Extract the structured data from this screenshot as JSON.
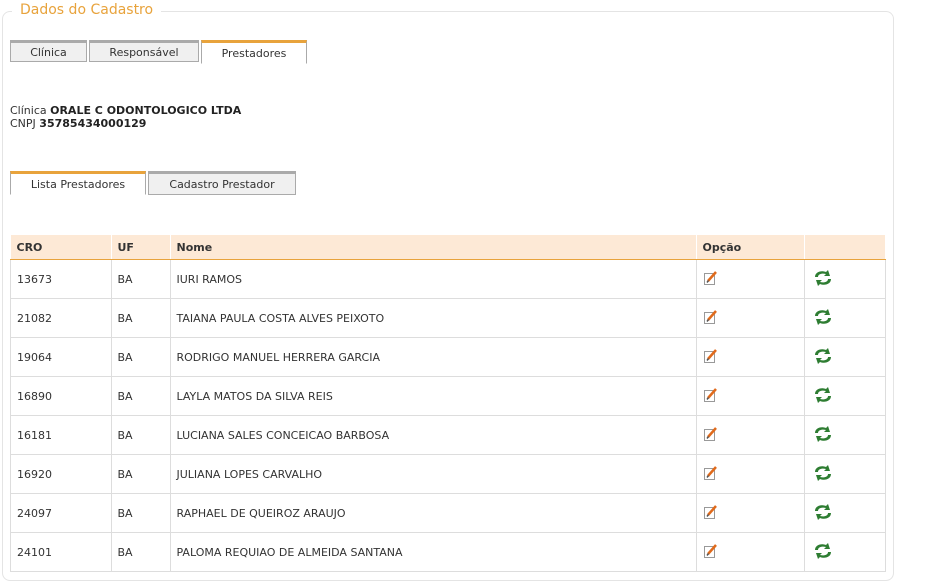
{
  "legend": "Dados do Cadastro",
  "top_tabs": [
    "Clínica",
    "Responsável",
    "Prestadores"
  ],
  "clinica_label": "Clínica",
  "clinica_name": "ORALE C ODONTOLOGICO LTDA",
  "cnpj_label": "CNPJ",
  "cnpj_value": "35785434000129",
  "sub_tabs": [
    "Lista Prestadores",
    "Cadastro Prestador"
  ],
  "table": {
    "headers": [
      "CRO",
      "UF",
      "Nome",
      "Opção",
      ""
    ],
    "rows": [
      {
        "cro": "13673",
        "uf": "BA",
        "nome": "IURI RAMOS"
      },
      {
        "cro": "21082",
        "uf": "BA",
        "nome": "TAIANA PAULA COSTA ALVES PEIXOTO"
      },
      {
        "cro": "19064",
        "uf": "BA",
        "nome": "RODRIGO MANUEL HERRERA GARCIA"
      },
      {
        "cro": "16890",
        "uf": "BA",
        "nome": "LAYLA MATOS DA SILVA REIS"
      },
      {
        "cro": "16181",
        "uf": "BA",
        "nome": "LUCIANA SALES CONCEICAO BARBOSA"
      },
      {
        "cro": "16920",
        "uf": "BA",
        "nome": "JULIANA LOPES CARVALHO"
      },
      {
        "cro": "24097",
        "uf": "BA",
        "nome": "RAPHAEL DE QUEIROZ ARAUJO"
      },
      {
        "cro": "24101",
        "uf": "BA",
        "nome": "PALOMA REQUIAO DE ALMEIDA SANTANA"
      }
    ]
  },
  "icons": {
    "edit": "edit-icon",
    "swap": "swap-arrows-icon"
  },
  "colors": {
    "accent": "#e8a33c",
    "header_bg": "#fde9d6",
    "swap_green": "#2e7d32"
  }
}
